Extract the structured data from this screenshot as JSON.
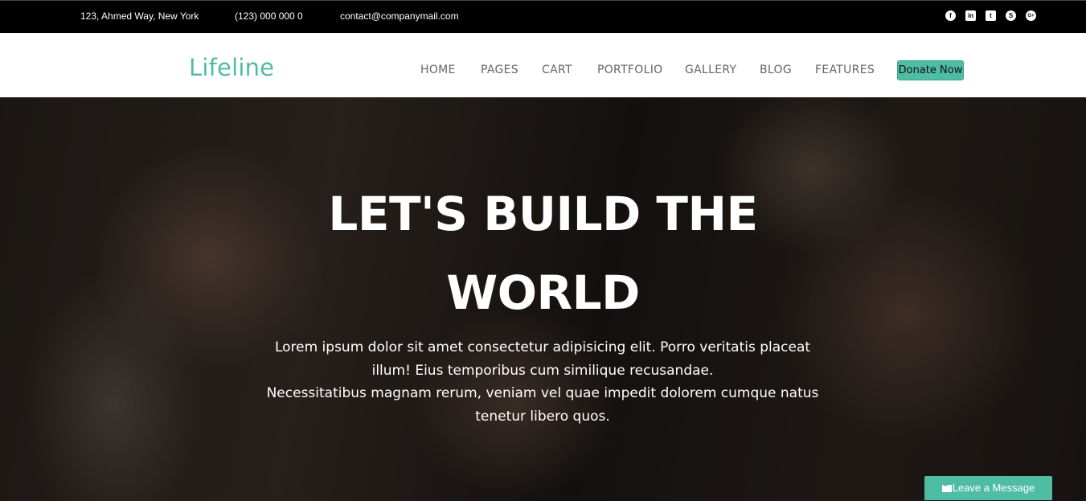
{
  "topbar": {
    "address": "123, Ahmed Way, New York",
    "phone": "(123) 000 000 0",
    "email": "contact@companymail.com",
    "social_icons": [
      {
        "name": "facebook-icon",
        "glyph": "f"
      },
      {
        "name": "linkedin-icon",
        "glyph": "in"
      },
      {
        "name": "twitter-icon",
        "glyph": "t"
      },
      {
        "name": "skype-icon",
        "glyph": "S"
      },
      {
        "name": "google-plus-icon",
        "glyph": "G+"
      }
    ]
  },
  "nav": {
    "logo": "Lifeline",
    "items": [
      "HOME",
      "PAGES",
      "CART",
      "PORTFOLIO",
      "GALLERY",
      "BLOG",
      "FEATURES"
    ],
    "donate_label": "Donate Now"
  },
  "hero": {
    "title_line1": "LET'S BUILD THE",
    "title_line2": "WORLD",
    "text_line1": "Lorem ipsum dolor sit amet consectetur adipisicing elit. Porro veritatis placeat",
    "text_line2": "illum! Eius temporibus cum similique recusandae.",
    "text_line3": "Necessitatibus magnam rerum, veniam vel quae impedit dolorem cumque natus",
    "text_line4": "tenetur libero quos."
  },
  "chat": {
    "label": "Leave a Message",
    "icon": "envelope-icon"
  },
  "colors": {
    "accent": "#4fbca4",
    "topbar_bg": "#000000"
  }
}
